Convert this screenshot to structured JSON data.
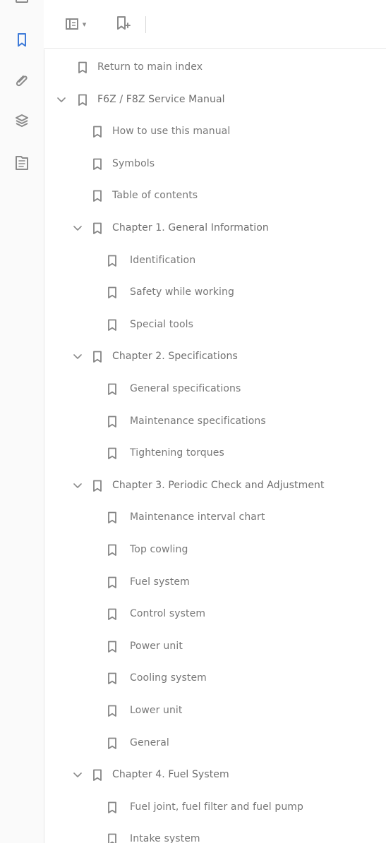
{
  "toolbar": {
    "panel_options_chevron": "▾"
  },
  "left_rail": [
    {
      "name": "bookmarks-icon"
    },
    {
      "name": "attachments-icon"
    },
    {
      "name": "layers-icon"
    },
    {
      "name": "tags-icon"
    }
  ],
  "tree": {
    "items": [
      {
        "label": "Return to main index",
        "level": 0,
        "expandable": false
      },
      {
        "label": "F6Z / F8Z Service Manual",
        "level": 0,
        "expandable": true,
        "expanded": true
      },
      {
        "label": "How to use this manual",
        "level": 1,
        "expandable": false
      },
      {
        "label": "Symbols",
        "level": 1,
        "expandable": false
      },
      {
        "label": "Table of contents",
        "level": 1,
        "expandable": false
      },
      {
        "label": "Chapter 1. General Information",
        "level": 1,
        "expandable": true,
        "expanded": true
      },
      {
        "label": "Identification",
        "level": 2,
        "expandable": false
      },
      {
        "label": "Safety while working",
        "level": 2,
        "expandable": false
      },
      {
        "label": "Special tools",
        "level": 2,
        "expandable": false
      },
      {
        "label": "Chapter 2. Specifications",
        "level": 1,
        "expandable": true,
        "expanded": true
      },
      {
        "label": "General specifications",
        "level": 2,
        "expandable": false
      },
      {
        "label": "Maintenance specifications",
        "level": 2,
        "expandable": false
      },
      {
        "label": "Tightening torques",
        "level": 2,
        "expandable": false
      },
      {
        "label": "Chapter 3. Periodic Check and Adjustment",
        "level": 1,
        "expandable": true,
        "expanded": true
      },
      {
        "label": "Maintenance interval chart",
        "level": 2,
        "expandable": false
      },
      {
        "label": "Top cowling",
        "level": 2,
        "expandable": false
      },
      {
        "label": "Fuel system",
        "level": 2,
        "expandable": false
      },
      {
        "label": "Control system",
        "level": 2,
        "expandable": false
      },
      {
        "label": "Power unit",
        "level": 2,
        "expandable": false
      },
      {
        "label": "Cooling system",
        "level": 2,
        "expandable": false
      },
      {
        "label": "Lower unit",
        "level": 2,
        "expandable": false
      },
      {
        "label": "General",
        "level": 2,
        "expandable": false
      },
      {
        "label": "Chapter 4. Fuel System",
        "level": 1,
        "expandable": true,
        "expanded": true
      },
      {
        "label": "Fuel joint, fuel filter and fuel pump",
        "level": 2,
        "expandable": false
      },
      {
        "label": "Intake system",
        "level": 2,
        "expandable": false
      }
    ]
  },
  "colors": {
    "active_icon": "#3f7bd9",
    "icon_gray": "#8b8b8b",
    "text_gray": "#777777",
    "line_gray": "#e5e5e5"
  }
}
